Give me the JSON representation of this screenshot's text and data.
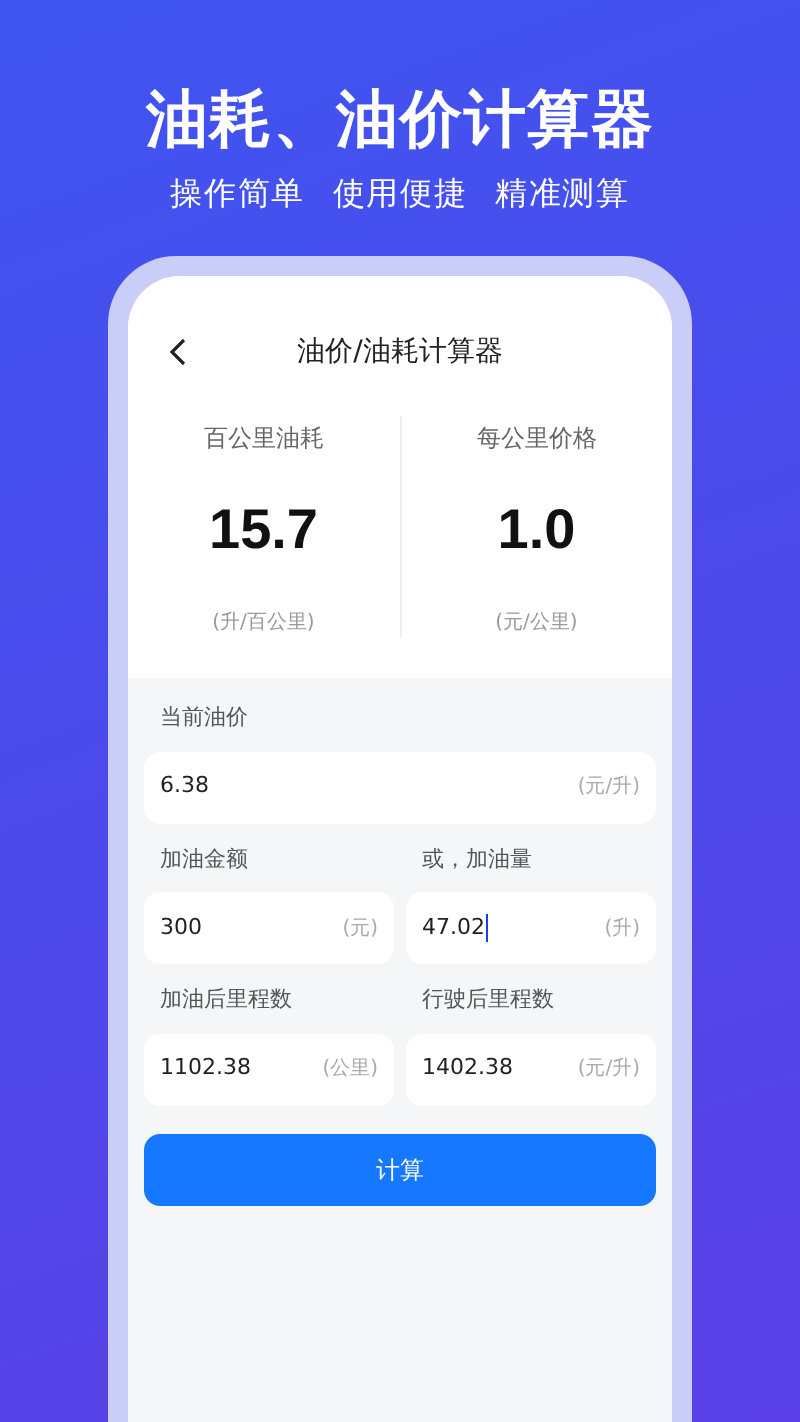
{
  "headline": "油耗、油价计算器",
  "tagline": [
    "操作简单",
    "使用便捷",
    "精准测算"
  ],
  "app": {
    "title": "油价/油耗计算器",
    "stats": [
      {
        "label": "百公里油耗",
        "value": "15.7",
        "unit": "(升/百公里)"
      },
      {
        "label": "每公里价格",
        "value": "1.0",
        "unit": "(元/公里)"
      }
    ],
    "rows": [
      [
        {
          "label": "当前油价",
          "value": "6.38",
          "unit": "(元/升)",
          "focused": false
        }
      ],
      [
        {
          "label": "加油金额",
          "value": "300",
          "unit": "(元)",
          "focused": false
        },
        {
          "label": "或，加油量",
          "value": "47.02",
          "unit": "(升)",
          "focused": true
        }
      ],
      [
        {
          "label": "加油后里程数",
          "value": "1102.38",
          "unit": "(公里)",
          "focused": false
        },
        {
          "label": "行驶后里程数",
          "value": "1402.38",
          "unit": "(元/升)",
          "focused": false
        }
      ]
    ],
    "button": "计算"
  }
}
